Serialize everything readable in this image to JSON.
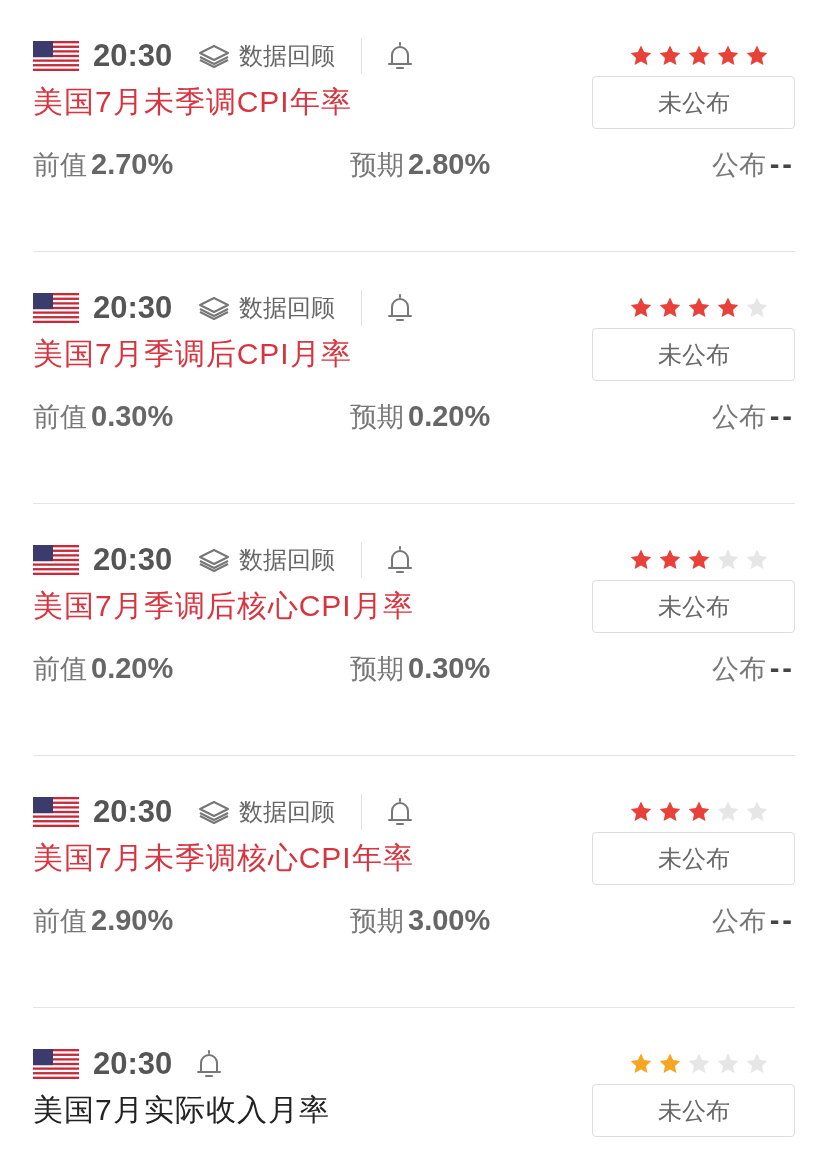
{
  "events": [
    {
      "time": "20:30",
      "review": "数据回顾",
      "highlighted": true,
      "stars": 5,
      "color": "#e8413a",
      "title": "美国7月未季调CPI年率",
      "status": "未公布",
      "previous_label": "前值",
      "previous": "2.70%",
      "forecast_label": "预期",
      "forecast": "2.80%",
      "actual_label": "公布",
      "actual": "--"
    },
    {
      "time": "20:30",
      "review": "数据回顾",
      "highlighted": true,
      "stars": 4,
      "color": "#e8413a",
      "title": "美国7月季调后CPI月率",
      "status": "未公布",
      "previous_label": "前值",
      "previous": "0.30%",
      "forecast_label": "预期",
      "forecast": "0.20%",
      "actual_label": "公布",
      "actual": "--"
    },
    {
      "time": "20:30",
      "review": "数据回顾",
      "highlighted": true,
      "stars": 3,
      "color": "#e8413a",
      "title": "美国7月季调后核心CPI月率",
      "status": "未公布",
      "previous_label": "前值",
      "previous": "0.20%",
      "forecast_label": "预期",
      "forecast": "0.30%",
      "actual_label": "公布",
      "actual": "--"
    },
    {
      "time": "20:30",
      "review": "数据回顾",
      "highlighted": true,
      "stars": 3,
      "color": "#e8413a",
      "title": "美国7月未季调核心CPI年率",
      "status": "未公布",
      "previous_label": "前值",
      "previous": "2.90%",
      "forecast_label": "预期",
      "forecast": "3.00%",
      "actual_label": "公布",
      "actual": "--"
    },
    {
      "time": "20:30",
      "highlighted": false,
      "stars": 2,
      "color": "#f5a623",
      "title": "美国7月实际收入月率",
      "status": "未公布"
    }
  ]
}
